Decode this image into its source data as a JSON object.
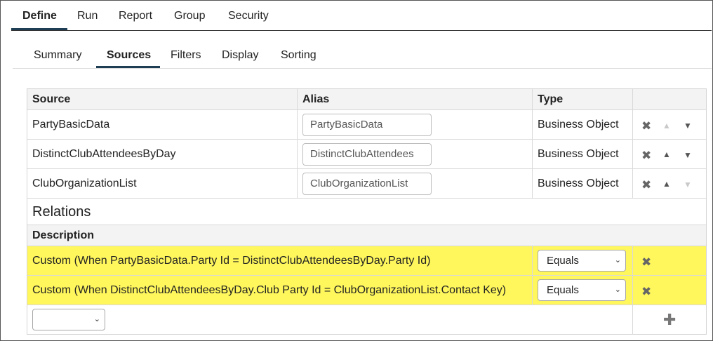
{
  "top_tabs": [
    "Define",
    "Run",
    "Report",
    "Group",
    "Security"
  ],
  "sub_tabs": [
    "Summary",
    "Sources",
    "Filters",
    "Display",
    "Sorting"
  ],
  "sources": {
    "headers": {
      "source": "Source",
      "alias": "Alias",
      "type": "Type"
    },
    "rows": [
      {
        "source": "PartyBasicData",
        "alias": "PartyBasicData",
        "type": "Business Object",
        "up_enabled": false,
        "down_enabled": true
      },
      {
        "source": "DistinctClubAttendeesByDay",
        "alias": "DistinctClubAttendees",
        "type": "Business Object",
        "up_enabled": true,
        "down_enabled": true
      },
      {
        "source": "ClubOrganizationList",
        "alias": "ClubOrganizationList",
        "type": "Business Object",
        "up_enabled": true,
        "down_enabled": false
      }
    ]
  },
  "relations": {
    "title": "Relations",
    "header": "Description",
    "rows": [
      {
        "description": "Custom (When PartyBasicData.Party Id = DistinctClubAttendeesByDay.Party Id)",
        "operator": "Equals"
      },
      {
        "description": "Custom (When DistinctClubAttendeesByDay.Club Party Id = ClubOrganizationList.Contact Key)",
        "operator": "Equals"
      }
    ],
    "new_relation_value": ""
  },
  "icons": {
    "delete": "✖",
    "up": "▲",
    "down": "▼",
    "add": "✚",
    "chevron": "⌄"
  },
  "colors": {
    "highlight": "#fff75c",
    "active_tab_underline": "#1d3e54"
  }
}
